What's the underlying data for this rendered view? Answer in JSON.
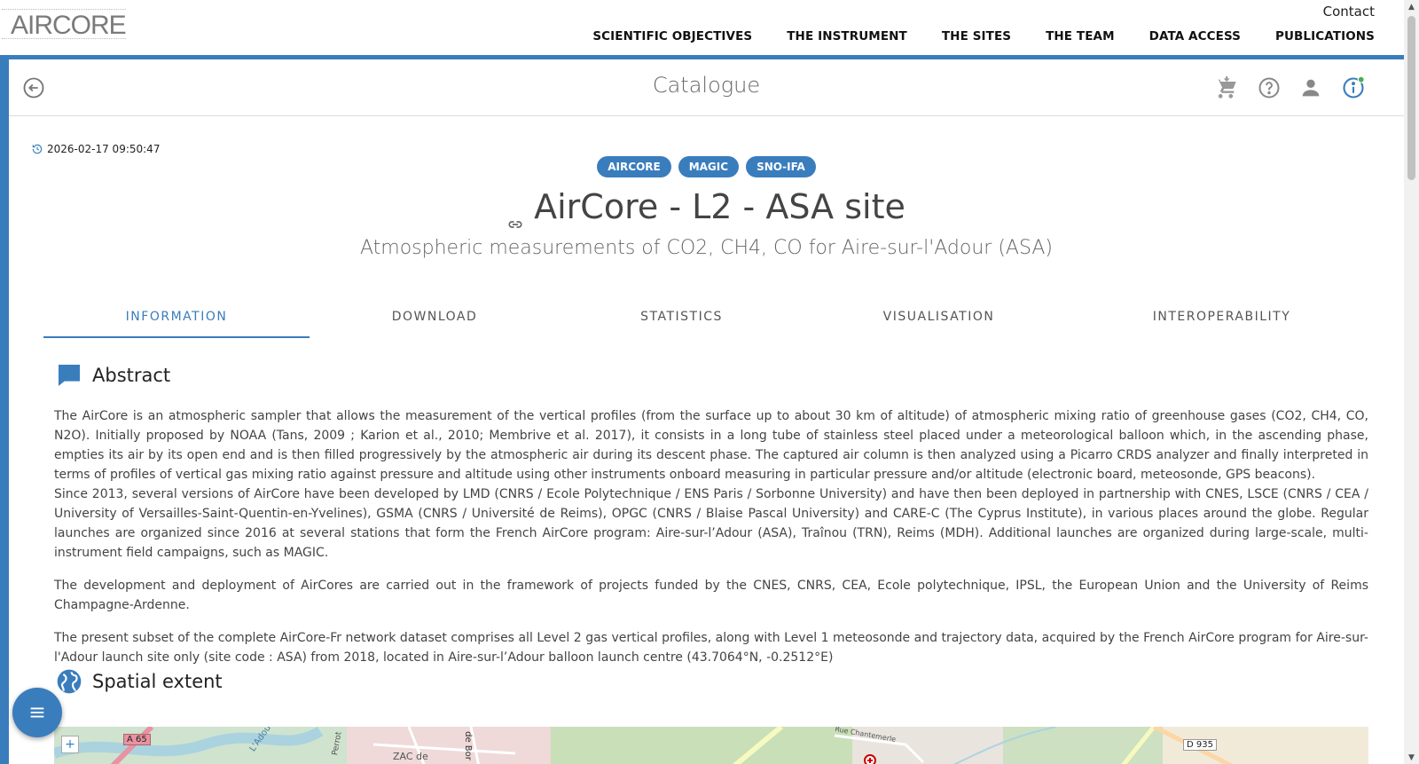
{
  "header": {
    "logo_text": "AIRCORE",
    "contact_label": "Contact",
    "nav": [
      {
        "label": "SCIENTIFIC OBJECTIVES"
      },
      {
        "label": "THE INSTRUMENT"
      },
      {
        "label": "THE SITES"
      },
      {
        "label": "THE TEAM"
      },
      {
        "label": "DATA ACCESS"
      },
      {
        "label": "PUBLICATIONS"
      }
    ]
  },
  "catalogue_bar": {
    "title": "Catalogue",
    "icons": [
      "back-arrow-icon",
      "cart-icon",
      "help-icon",
      "user-icon",
      "info-icon"
    ],
    "info_status_color": "#4caf50"
  },
  "dataset": {
    "timestamp": "2026-02-17 09:50:47",
    "tags": [
      "AIRCORE",
      "MAGIC",
      "SNO-IFA"
    ],
    "title": "AirCore - L2 - ASA site",
    "subtitle": "Atmospheric measurements of CO2, CH4, CO for Aire-sur-l'Adour (ASA)"
  },
  "tabs": [
    {
      "label": "INFORMATION",
      "active": true
    },
    {
      "label": "DOWNLOAD",
      "active": false
    },
    {
      "label": "STATISTICS",
      "active": false
    },
    {
      "label": "VISUALISATION",
      "active": false
    },
    {
      "label": "INTEROPERABILITY",
      "active": false
    }
  ],
  "abstract": {
    "heading": "Abstract",
    "paragraphs": [
      "The AirCore is an atmospheric sampler that allows the measurement of the vertical profiles (from the surface up to about 30 km of altitude) of atmospheric mixing ratio of greenhouse gases (CO2, CH4, CO, N2O). Initially proposed by NOAA (Tans, 2009 ; Karion et al., 2010; Membrive et al. 2017), it consists in a long tube of stainless steel placed under a meteorological balloon which, in the ascending phase, empties its air by its open end and is then filled progressively by the atmospheric air during its descent phase. The captured air column is then analyzed using a Picarro CRDS analyzer and finally interpreted in terms of profiles of vertical gas mixing ratio against pressure and altitude using other instruments onboard measuring in particular pressure and/or altitude (electronic board, meteosonde, GPS beacons).",
      "Since 2013, several versions of AirCore have been developed by LMD (CNRS / Ecole Polytechnique / ENS Paris / Sorbonne University) and have then been deployed in partnership with CNES, LSCE (CNRS / CEA / University of Versailles-Saint-Quentin-en-Yvelines), GSMA (CNRS / Université de Reims), OPGC (CNRS / Blaise Pascal University) and CARE-C (The Cyprus Institute), in various places around the globe. Regular launches are organized since 2016 at several stations that form the French AirCore program: Aire-sur-l’Adour (ASA), Traînou (TRN), Reims (MDH). Additional launches are organized during large-scale, multi-instrument field campaigns, such as MAGIC.",
      "The development and deployment of AirCores are carried out in the framework of projects funded by the CNES, CNRS, CEA, Ecole polytechnique, IPSL, the European Union and the University of Reims Champagne-Ardenne.",
      "The present subset of the complete AirCore-Fr network dataset comprises all Level 2 gas vertical profiles, along with Level 1 meteosonde and trajectory data, acquired by the French AirCore program for Aire-sur-l'Adour launch site only (site code : ASA) from 2018, located in Aire-sur-l’Adour balloon launch centre (43.7064°N, -0.2512°E)"
    ]
  },
  "spatial": {
    "heading": "Spatial extent",
    "map_labels": [
      "A 65",
      "L'Adour",
      "ZAC de",
      "D 935",
      "Rue Chantemerle",
      "Perrot",
      "de Bor"
    ],
    "zoom_in": "+"
  },
  "colors": {
    "accent": "#3a7dbd"
  }
}
